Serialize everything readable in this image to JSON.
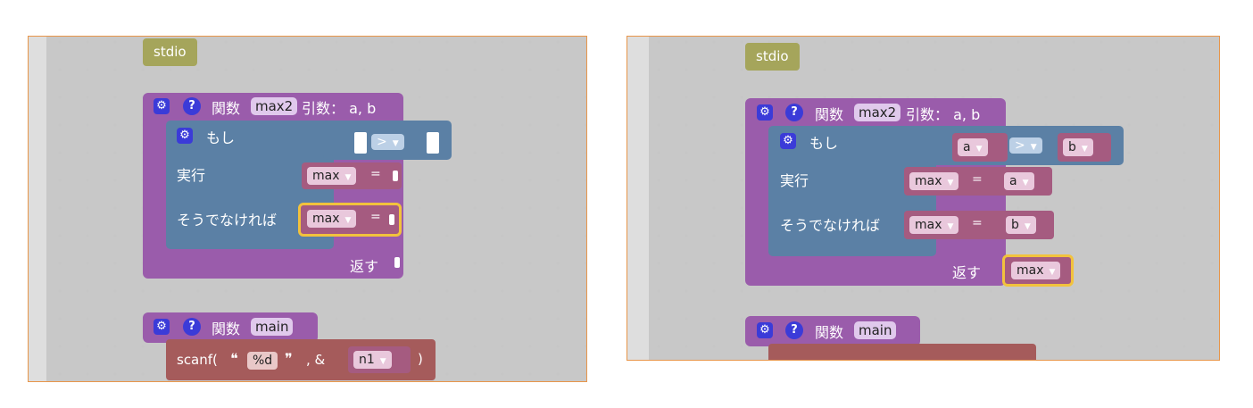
{
  "left": {
    "stdio_label": "stdio",
    "max2_func": {
      "keyword": "関数",
      "name": "max2",
      "args_label": "引数： a, b"
    },
    "if_block": {
      "if_label": "もし",
      "compare_op": ">",
      "then_label": "実行",
      "else_label": "そうでなければ"
    },
    "assign1": {
      "var": "max",
      "eq": "="
    },
    "assign2": {
      "var": "max",
      "eq": "="
    },
    "return_label": "返す",
    "main_func": {
      "keyword": "関数",
      "name": "main"
    },
    "scanf": {
      "prefix": "scanf(",
      "open_quote": "❝",
      "format": "%d",
      "close_quote": "❞",
      "amp": ", &",
      "var": "n1",
      "close": ")"
    }
  },
  "right": {
    "stdio_label": "stdio",
    "max2_func": {
      "keyword": "関数",
      "name": "max2",
      "args_label": "引数： a, b"
    },
    "if_block": {
      "if_label": "もし",
      "left_var": "a",
      "compare_op": ">",
      "right_var": "b",
      "then_label": "実行",
      "else_label": "そうでなければ"
    },
    "assign1": {
      "var": "max",
      "eq": "=",
      "value": "a"
    },
    "assign2": {
      "var": "max",
      "eq": "=",
      "value": "b"
    },
    "return_label": "返す",
    "return_value": "max",
    "main_func": {
      "keyword": "関数",
      "name": "main"
    }
  },
  "icons": {
    "gear": "gear-icon",
    "help": "help-icon",
    "dropdown": "dropdown-arrow-icon"
  },
  "colors": {
    "function": "#9a5cab",
    "logic": "#5b80a5",
    "variable": "#a55b80",
    "io": "#a55b5b",
    "library": "#a5a55b",
    "selection": "#f2c23c"
  }
}
